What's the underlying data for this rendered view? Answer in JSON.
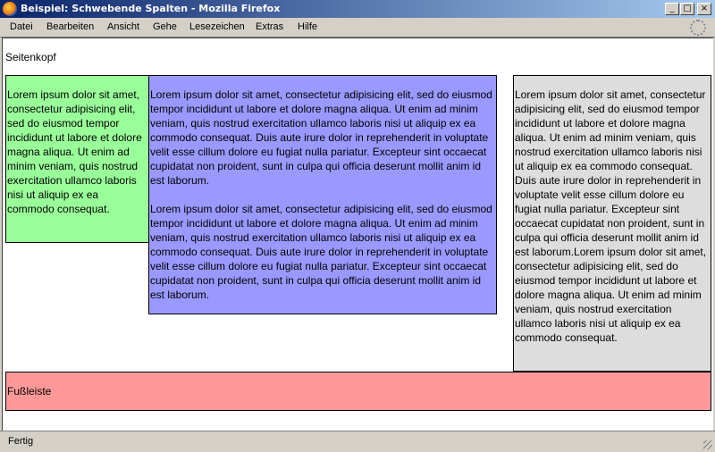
{
  "window": {
    "title": "Beispiel: Schwebende Spalten - Mozilla Firefox",
    "buttons": {
      "minimize": "_",
      "maximize": "□",
      "close": "×"
    }
  },
  "menu": [
    "Datei",
    "Bearbeiten",
    "Ansicht",
    "Gehe",
    "Lesezeichen",
    "Extras",
    "Hilfe"
  ],
  "page": {
    "header": "Seitenkopf",
    "left_text": "Lorem ipsum dolor sit amet, consectetur adipisicing elit, sed do eiusmod tempor incididunt ut labore et dolore magna aliqua. Ut enim ad minim veniam, quis nostrud exercitation ullamco laboris nisi ut aliquip ex ea commodo consequat.",
    "middle_paragraphs": [
      "Lorem ipsum dolor sit amet, consectetur adipisicing elit, sed do eiusmod tempor incididunt ut labore et dolore magna aliqua. Ut enim ad minim veniam, quis nostrud exercitation ullamco laboris nisi ut aliquip ex ea commodo consequat. Duis aute irure dolor in reprehenderit in voluptate velit esse cillum dolore eu fugiat nulla pariatur. Excepteur sint occaecat cupidatat non proident, sunt in culpa qui officia deserunt mollit anim id est laborum.",
      "Lorem ipsum dolor sit amet, consectetur adipisicing elit, sed do eiusmod tempor incididunt ut labore et dolore magna aliqua. Ut enim ad minim veniam, quis nostrud exercitation ullamco laboris nisi ut aliquip ex ea commodo consequat. Duis aute irure dolor in reprehenderit in voluptate velit esse cillum dolore eu fugiat nulla pariatur. Excepteur sint occaecat cupidatat non proident, sunt in culpa qui officia deserunt mollit anim id est laborum."
    ],
    "right_text": "Lorem ipsum dolor sit amet, consectetur adipisicing elit, sed do eiusmod tempor incididunt ut labore et dolore magna aliqua. Ut enim ad minim veniam, quis nostrud exercitation ullamco laboris nisi ut aliquip ex ea commodo consequat. Duis aute irure dolor in reprehenderit in voluptate velit esse cillum dolore eu fugiat nulla pariatur. Excepteur sint occaecat cupidatat non proident, sunt in culpa qui officia deserunt mollit anim id est laborum.Lorem ipsum dolor sit amet, consectetur adipisicing elit, sed do eiusmod tempor incididunt ut labore et dolore magna aliqua. Ut enim ad minim veniam, quis nostrud exercitation ullamco laboris nisi ut aliquip ex ea commodo consequat.",
    "footer": "Fußleiste"
  },
  "status": "Fertig",
  "colors": {
    "left_column": "#99ff99",
    "middle_column": "#9999ff",
    "right_column": "#dddddd",
    "footer": "#ff9999",
    "title_bar_start": "#0a246a",
    "title_bar_end": "#a6caf0"
  },
  "icons": [
    "firefox-logo-icon",
    "throbber-icon",
    "resize-grip-icon"
  ]
}
